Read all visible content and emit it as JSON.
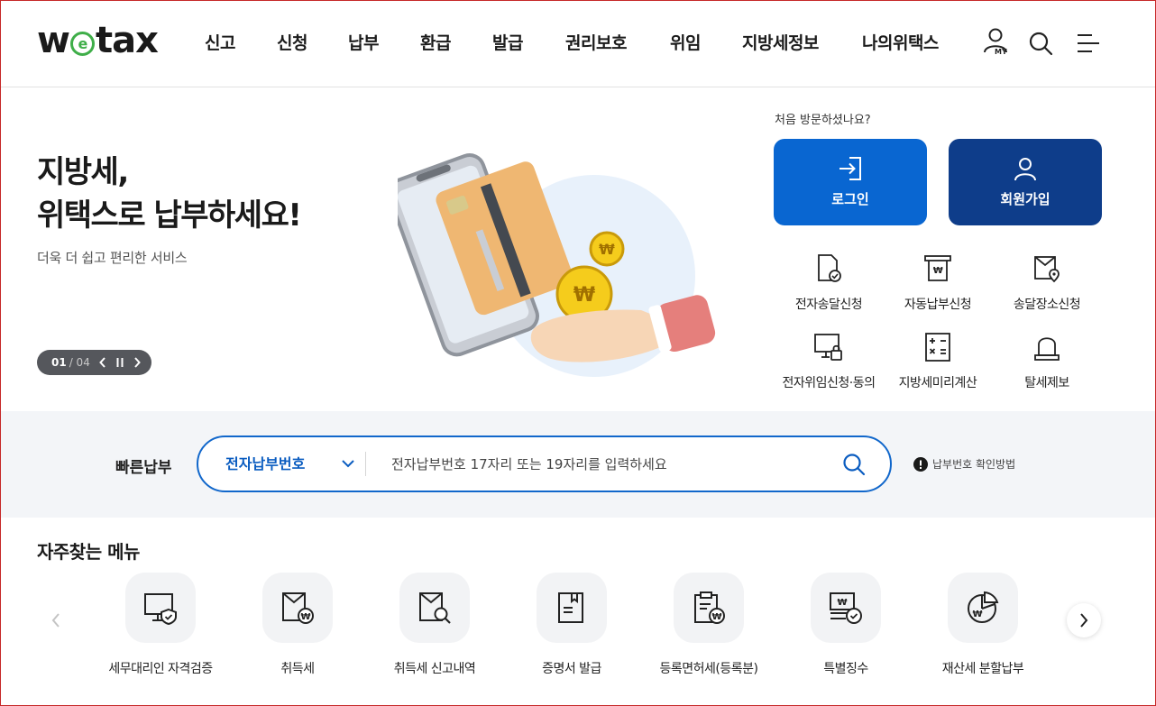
{
  "header": {
    "logo_text_before": "w",
    "logo_text_e": "e",
    "logo_text_after": "tax",
    "nav": [
      "신고",
      "신청",
      "납부",
      "환급",
      "발급",
      "권리보호",
      "위임",
      "지방세정보",
      "나의위택스"
    ],
    "my_label": "MY"
  },
  "hero": {
    "title_line1": "지방세,",
    "title_line2": "위택스로 납부하세요!",
    "subtitle": "더욱 더 쉽고 편리한 서비스",
    "pager_current": "01",
    "pager_total": "/ 04"
  },
  "side": {
    "first_visit": "처음 방문하셨나요?",
    "login_label": "로그인",
    "join_label": "회원가입",
    "quick": [
      "전자송달신청",
      "자동납부신청",
      "송달장소신청",
      "전자위임신청·동의",
      "지방세미리계산",
      "탈세제보"
    ]
  },
  "search": {
    "label": "빠른납부",
    "select_value": "전자납부번호",
    "placeholder": "전자납부번호 17자리 또는 19자리를 입력하세요",
    "help": "납부번호 확인방법"
  },
  "frequent": {
    "title": "자주찾는 메뉴",
    "items": [
      "세무대리인 자격검증",
      "취득세",
      "취득세 신고내역",
      "증명서 발급",
      "등록면허세(등록분)",
      "특별징수",
      "재산세 분할납부"
    ]
  },
  "colors": {
    "primary": "#0966d1",
    "primary_dark": "#0e3d8a",
    "logo_green": "#3fae49"
  }
}
